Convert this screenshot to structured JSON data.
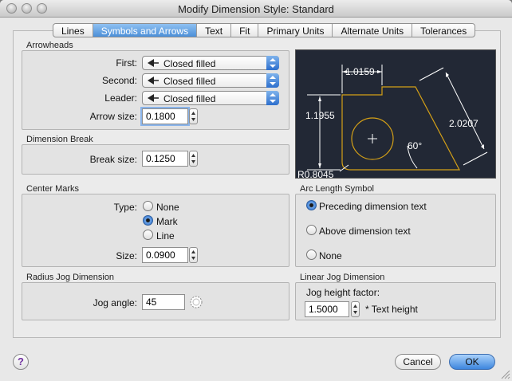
{
  "window": {
    "title": "Modify Dimension Style: Standard"
  },
  "tabs": [
    {
      "label": "Lines"
    },
    {
      "label": "Symbols and Arrows",
      "active": true
    },
    {
      "label": "Text"
    },
    {
      "label": "Fit"
    },
    {
      "label": "Primary Units"
    },
    {
      "label": "Alternate Units"
    },
    {
      "label": "Tolerances"
    }
  ],
  "arrowheads": {
    "section_label": "Arrowheads",
    "first_label": "First:",
    "first_value": "Closed filled",
    "second_label": "Second:",
    "second_value": "Closed filled",
    "leader_label": "Leader:",
    "leader_value": "Closed filled",
    "arrow_size_label": "Arrow size:",
    "arrow_size_value": "0.1800"
  },
  "dimension_break": {
    "section_label": "Dimension Break",
    "break_size_label": "Break size:",
    "break_size_value": "0.1250"
  },
  "center_marks": {
    "section_label": "Center Marks",
    "type_label": "Type:",
    "options": [
      "None",
      "Mark",
      "Line"
    ],
    "selected": "Mark",
    "size_label": "Size:",
    "size_value": "0.0900"
  },
  "radius_jog": {
    "section_label": "Radius Jog Dimension",
    "jog_angle_label": "Jog angle:",
    "jog_angle_value": "45"
  },
  "arc_length": {
    "section_label": "Arc Length Symbol",
    "options": [
      "Preceding dimension text",
      "Above dimension text",
      "None"
    ],
    "selected": "Preceding dimension text"
  },
  "linear_jog": {
    "section_label": "Linear Jog Dimension",
    "factor_label": "Jog height factor:",
    "factor_value": "1.5000",
    "factor_suffix": "* Text height"
  },
  "preview": {
    "dim_top": "1.0159",
    "dim_left": "1.1955",
    "dim_right": "2.0207",
    "dim_angle": "60°",
    "dim_radius": "R0.8045"
  },
  "footer": {
    "help_label": "?",
    "cancel_label": "Cancel",
    "ok_label": "OK"
  },
  "colors": {
    "accent": "#3d86de",
    "preview_background": "#222835",
    "preview_geometry": "#d4a017"
  }
}
